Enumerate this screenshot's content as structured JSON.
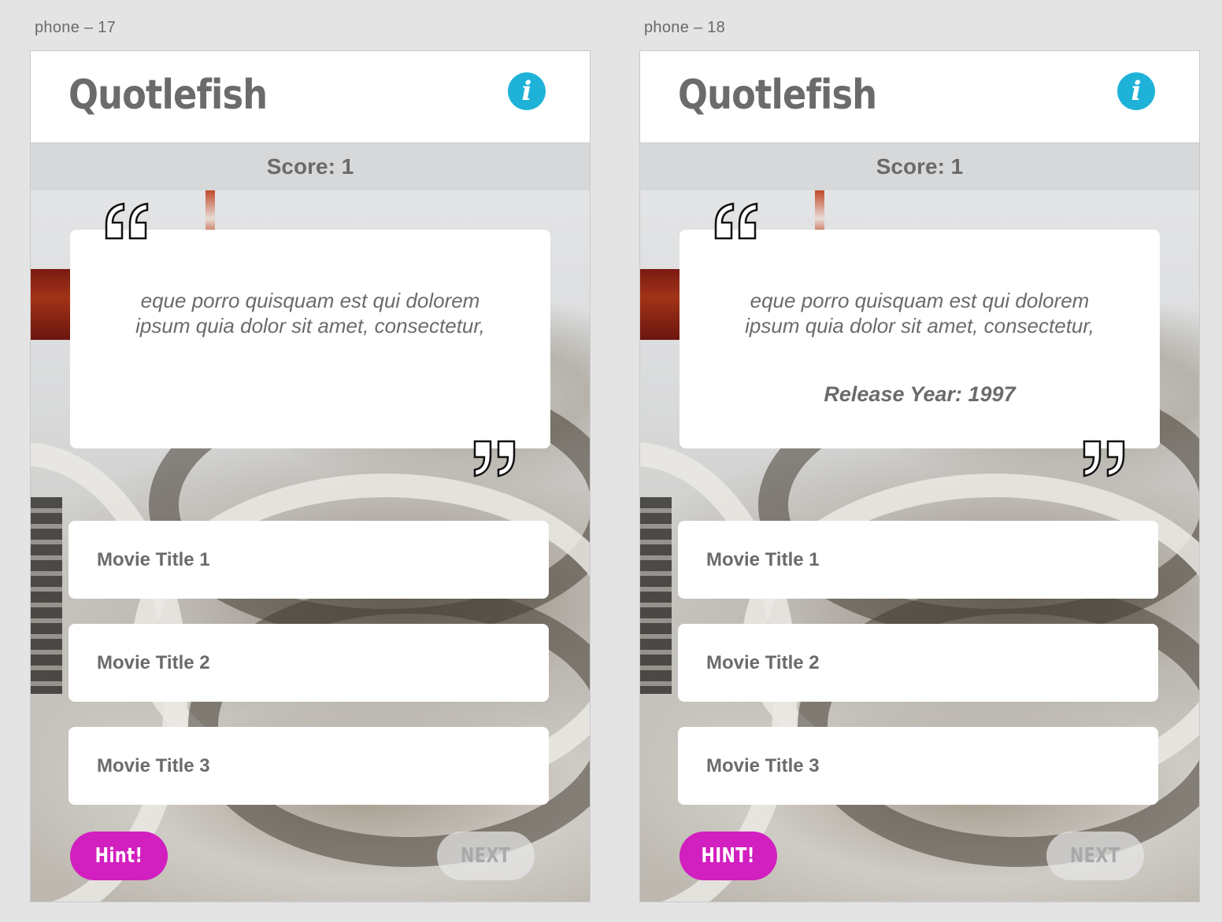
{
  "artboards": [
    {
      "label": "phone – 17",
      "app_title": "Quotlefish",
      "info_icon_glyph": "i",
      "score_text": "Score: 1",
      "quote_line_1": "eque porro quisquam est qui dolorem",
      "quote_line_2": "ipsum quia dolor sit amet, consectetur,",
      "release_year": "",
      "answers": [
        "Movie Title 1",
        "Movie Title 2",
        "Movie Title 3"
      ],
      "hint_label": "Hint!",
      "next_label": "NEXT"
    },
    {
      "label": "phone – 18",
      "app_title": "Quotlefish",
      "info_icon_glyph": "i",
      "score_text": "Score: 1",
      "quote_line_1": "eque porro quisquam est qui dolorem",
      "quote_line_2": "ipsum quia dolor sit amet, consectetur,",
      "release_year": "Release Year: 1997",
      "answers": [
        "Movie Title 1",
        "Movie Title 2",
        "Movie Title 3"
      ],
      "hint_label": "HINT!",
      "next_label": "NEXT"
    }
  ],
  "colors": {
    "canvas_bg": "#e4e4e4",
    "title_gray": "#6b6b6b",
    "info_blue": "#1fb2d8",
    "score_bar_bg": "#d6d8da",
    "hint_magenta": "#d21fbf",
    "next_disabled_bg": "#e6e6e6",
    "next_disabled_text": "#a9a9a9"
  },
  "icons": {
    "info": "info-icon",
    "open_quote": "open-quote-icon",
    "close_quote": "close-quote-icon"
  }
}
